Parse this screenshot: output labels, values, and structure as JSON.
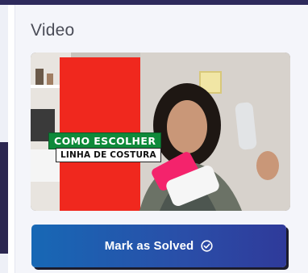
{
  "card": {
    "title": "Video"
  },
  "video": {
    "badge_line1": "COMO ESCOLHER",
    "badge_line2": "LINHA DE COSTURA"
  },
  "actions": {
    "mark_solved_label": "Mark as Solved",
    "check_icon": "check-circle-icon",
    "button_color": "#1768b5"
  }
}
